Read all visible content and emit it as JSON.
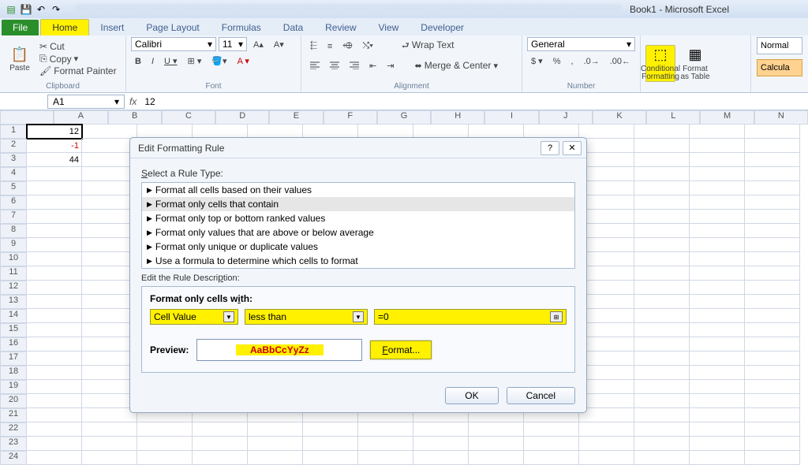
{
  "window": {
    "title": "Book1 - Microsoft Excel"
  },
  "tabs": {
    "file": "File",
    "home": "Home",
    "insert": "Insert",
    "pagelayout": "Page Layout",
    "formulas": "Formulas",
    "data": "Data",
    "review": "Review",
    "view": "View",
    "developer": "Developer"
  },
  "ribbon": {
    "clipboard": {
      "paste": "Paste",
      "cut": "Cut",
      "copy": "Copy",
      "painter": "Format Painter",
      "label": "Clipboard"
    },
    "font": {
      "name": "Calibri",
      "size": "11",
      "label": "Font"
    },
    "alignment": {
      "wrap": "Wrap Text",
      "merge": "Merge & Center",
      "label": "Alignment"
    },
    "number": {
      "format": "General",
      "label": "Number"
    },
    "styles": {
      "cond": "Conditional Formatting",
      "fat": "Format as Table",
      "normal": "Normal",
      "calc": "Calcula"
    }
  },
  "formula": {
    "cellname": "A1",
    "value": "12"
  },
  "columns": [
    "A",
    "B",
    "C",
    "D",
    "E",
    "F",
    "G",
    "H",
    "I",
    "J",
    "K",
    "L",
    "M",
    "N"
  ],
  "cells": {
    "A1": "12",
    "A2": "-1",
    "A3": "44"
  },
  "dialog": {
    "title": "Edit Formatting Rule",
    "select_label": "Select a Rule Type:",
    "rules": [
      "Format all cells based on their values",
      "Format only cells that contain",
      "Format only top or bottom ranked values",
      "Format only values that are above or below average",
      "Format only unique or duplicate values",
      "Use a formula to determine which cells to format"
    ],
    "edit_label": "Edit the Rule Description:",
    "desc_header": "Format only cells with:",
    "combo1": "Cell Value",
    "combo2": "less than",
    "input": "=0",
    "preview_label": "Preview:",
    "preview_sample": "AaBbCcYyZz",
    "format_btn": "Format...",
    "ok": "OK",
    "cancel": "Cancel"
  }
}
